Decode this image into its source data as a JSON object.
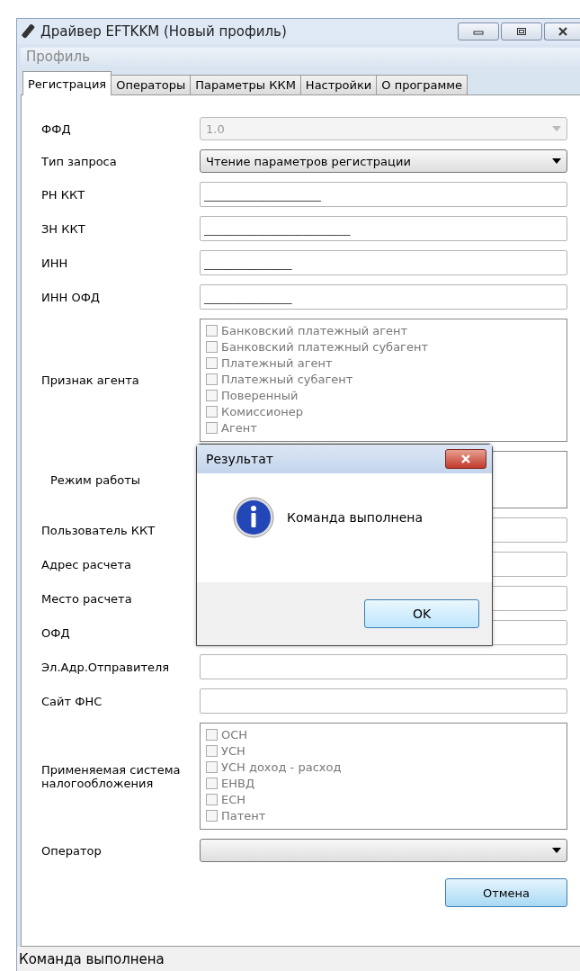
{
  "window": {
    "title": "Драйвер EFTKKM (Новый профиль)"
  },
  "menu": [
    "Профиль"
  ],
  "tabs": [
    {
      "label": "Регистрация",
      "selected": true
    },
    {
      "label": "Операторы",
      "selected": false
    },
    {
      "label": "Параметры ККМ",
      "selected": false
    },
    {
      "label": "Настройки",
      "selected": false
    },
    {
      "label": "О программе",
      "selected": false
    }
  ],
  "form": [
    {
      "kind": "combo",
      "label": "ФФД",
      "value": "1.0",
      "disabled": true
    },
    {
      "kind": "combo",
      "label": "Тип запроса",
      "value": "Чтение параметров регистрации",
      "disabled": false
    },
    {
      "kind": "text",
      "label": "РН ККТ",
      "value": "____________________"
    },
    {
      "kind": "text",
      "label": "ЗН ККТ",
      "value": "_________________________"
    },
    {
      "kind": "text",
      "label": "ИНН",
      "value": "_______________"
    },
    {
      "kind": "text",
      "label": "ИНН ОФД",
      "value": "_______________"
    },
    {
      "kind": "checklist",
      "label": "Признак агента",
      "disabled": true,
      "options": [
        {
          "label": "Банковский платежный агент",
          "checked": false
        },
        {
          "label": "Банковский платежный субагент",
          "checked": false
        },
        {
          "label": "Платежный агент",
          "checked": false
        },
        {
          "label": "Платежный субагент",
          "checked": false
        },
        {
          "label": "Поверенный",
          "checked": false
        },
        {
          "label": "Комиссионер",
          "checked": false
        },
        {
          "label": "Агент",
          "checked": false
        }
      ]
    },
    {
      "kind": "list",
      "label": "Режим работы"
    },
    {
      "kind": "text",
      "label": "Пользователь ККТ"
    },
    {
      "kind": "text",
      "label": "Адрес расчета"
    },
    {
      "kind": "text",
      "label": "Место расчета"
    },
    {
      "kind": "text",
      "label": "ОФД"
    },
    {
      "kind": "text",
      "label": "Эл.Адр.Отправителя"
    },
    {
      "kind": "text",
      "label": "Сайт ФНС"
    },
    {
      "kind": "checklist",
      "label": "Применяемая система налогообложения",
      "disabled": true,
      "options": [
        {
          "label": "ОСН",
          "checked": false
        },
        {
          "label": "УСН",
          "checked": false
        },
        {
          "label": "УСН доход - расход",
          "checked": false
        },
        {
          "label": "ЕНВД",
          "checked": false
        },
        {
          "label": "ЕСН",
          "checked": false
        },
        {
          "label": "Патент",
          "checked": false
        }
      ]
    },
    {
      "kind": "combo",
      "label": "Оператор",
      "disabled": false
    }
  ],
  "cancel_button": "Отмена",
  "dialog": {
    "title": "Результат",
    "message": "Команда выполнена",
    "button": "OK"
  },
  "status_bar": "Команда выполнена"
}
